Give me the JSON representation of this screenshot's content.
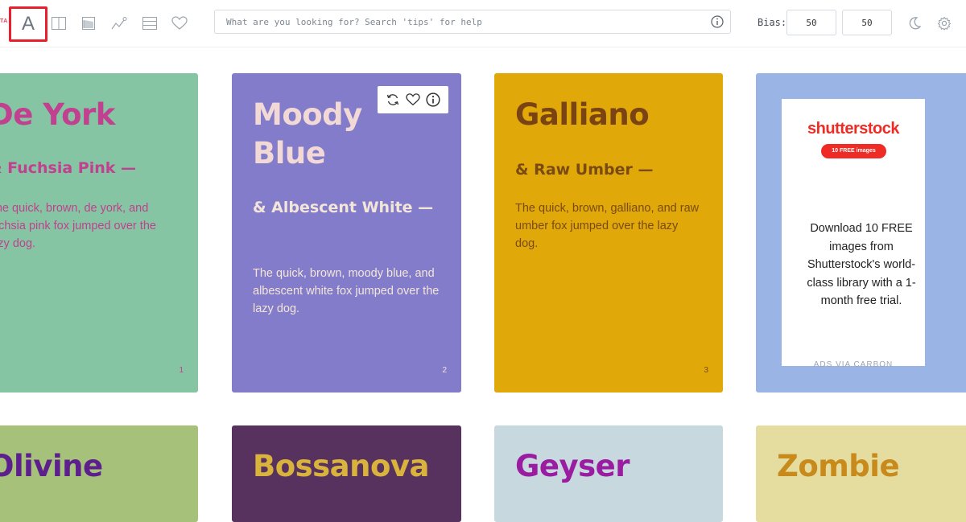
{
  "toolbar": {
    "brand_sliver": "TA",
    "tools": [
      {
        "name": "font-tool",
        "icon": "letter-a-icon",
        "label": "A",
        "selected": true
      },
      {
        "name": "split-view-tool",
        "icon": "columns-icon"
      },
      {
        "name": "gradient-tool",
        "icon": "gradient-icon"
      },
      {
        "name": "chart-tool",
        "icon": "line-chart-icon"
      },
      {
        "name": "list-view-tool",
        "icon": "list-icon"
      },
      {
        "name": "favorites-tool",
        "icon": "heart-icon"
      }
    ],
    "search_placeholder": "What are you looking for? Search 'tips' for help",
    "search_value": "",
    "bias_label": "Bias:",
    "bias_a": "50",
    "bias_b": "50"
  },
  "cards": [
    {
      "title": "De York",
      "subtitle": "& Fuchsia Pink —",
      "body": "The quick, brown, de york, and fuchsia pink fox jumped over the lazy dog.",
      "number": "1",
      "bg": "#86c5a3",
      "title_color": "#c1408f",
      "text_color": "#c1408f"
    },
    {
      "title": "Moody Blue",
      "subtitle": "& Albescent White —",
      "body": "The quick, brown, moody blue, and albescent white fox jumped over the lazy dog.",
      "number": "2",
      "bg": "#837ccb",
      "title_color": "#f3d9d5",
      "text_color": "#f3e6d8"
    },
    {
      "title": "Galliano",
      "subtitle": "& Raw Umber —",
      "body": "The quick, brown, galliano, and raw umber fox jumped over the lazy dog.",
      "number": "3",
      "bg": "#e0a808",
      "title_color": "#7a4313",
      "text_color": "#7a4a13"
    },
    {
      "title": "Olivine",
      "bg": "#a6c27a",
      "title_color": "#5d1e8e"
    },
    {
      "title": "Bossanova",
      "bg": "#57325f",
      "title_color": "#d9b33c"
    },
    {
      "title": "Geyser",
      "bg": "#c8d8df",
      "title_color": "#9a1da1"
    },
    {
      "title": "Zombie",
      "bg": "#e5dd9f",
      "title_color": "#c88a1a"
    }
  ],
  "ad": {
    "bg": "#9ab4e6",
    "logo": "shutterstock",
    "badge": "10 FREE images",
    "text": "Download 10 FREE images from Shutterstock's world-class library with a 1-month free trial.",
    "via": "ADS VIA CARBON"
  },
  "colors": {
    "selection_border": "#e8202e",
    "icon_gray": "#9aa3ad"
  }
}
